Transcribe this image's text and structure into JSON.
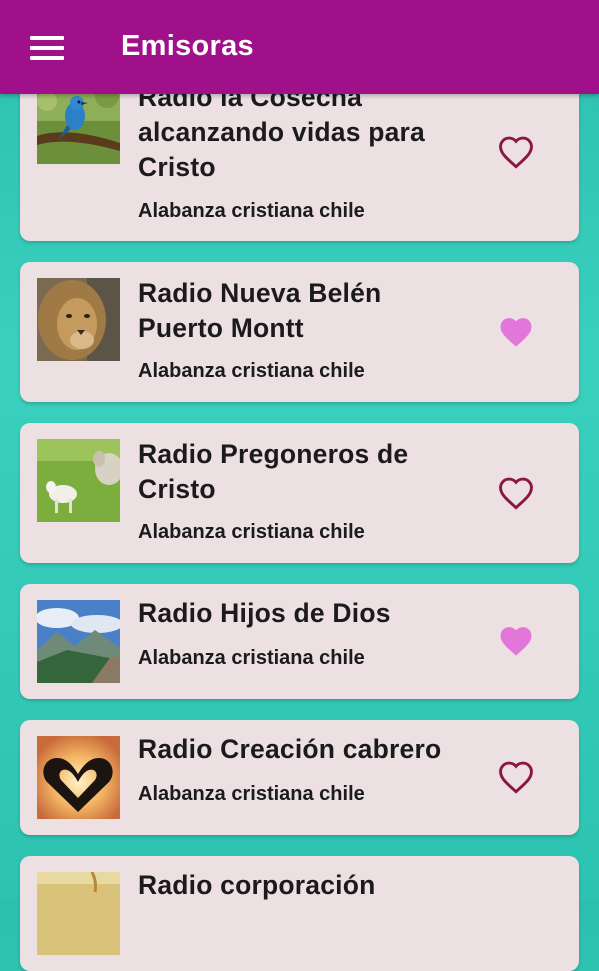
{
  "appbar": {
    "title": "Emisoras",
    "menu_icon": "hamburger-menu-icon"
  },
  "colors": {
    "appbar": "#a0108a",
    "card": "#ece0e2",
    "heart_outline": "#8a1842",
    "heart_filled": "#e276d9",
    "background": "#33c6b4"
  },
  "stations": [
    {
      "title_lines": [
        "Radio la Cosecha",
        "alcanzando vidas para",
        "Cristo"
      ],
      "subtitle": "Alabanza cristiana chile",
      "favorite": false,
      "image": "bluebird"
    },
    {
      "title_lines": [
        "Radio Nueva Belén",
        "Puerto Montt"
      ],
      "subtitle": "Alabanza cristiana chile",
      "favorite": true,
      "image": "lion"
    },
    {
      "title_lines": [
        "Radio Pregoneros de",
        "Cristo"
      ],
      "subtitle": "Alabanza cristiana chile",
      "favorite": false,
      "image": "sheep"
    },
    {
      "title_lines": [
        "Radio Hijos de Dios"
      ],
      "subtitle": "Alabanza cristiana chile",
      "favorite": true,
      "image": "mountains"
    },
    {
      "title_lines": [
        "Radio Creación cabrero"
      ],
      "subtitle": "Alabanza cristiana chile",
      "favorite": false,
      "image": "heart-hands"
    },
    {
      "title_lines": [
        "Radio corporación"
      ],
      "subtitle": "",
      "favorite": false,
      "image": "field"
    }
  ]
}
